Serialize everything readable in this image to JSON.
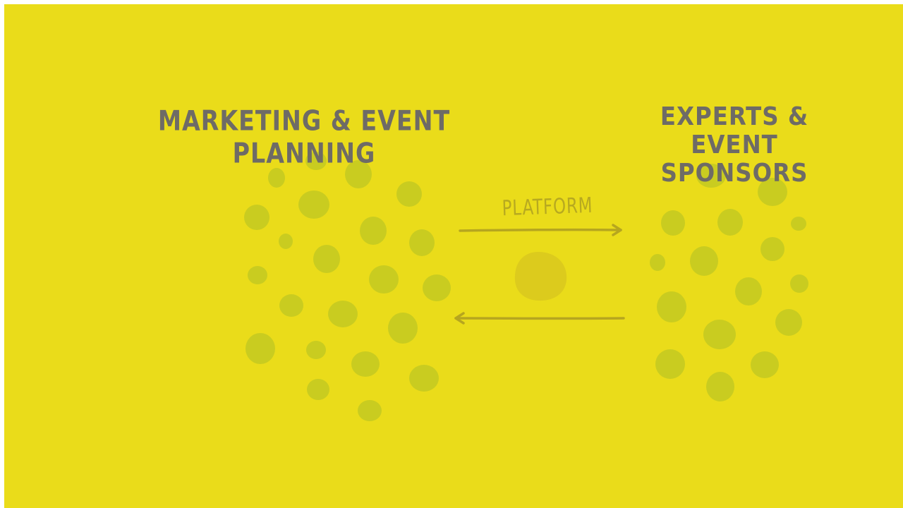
{
  "left_group": {
    "title": "Marketing & Event Planning"
  },
  "right_group": {
    "title": "Experts & Event Sponsors"
  },
  "flow": {
    "label": "PLATFORM"
  },
  "colors": {
    "background": "#eadc1a",
    "dot": "#c9cc20",
    "center_blob": "#dccb1d",
    "arrow": "#b6a61f",
    "title_text": "#6e6b66"
  }
}
